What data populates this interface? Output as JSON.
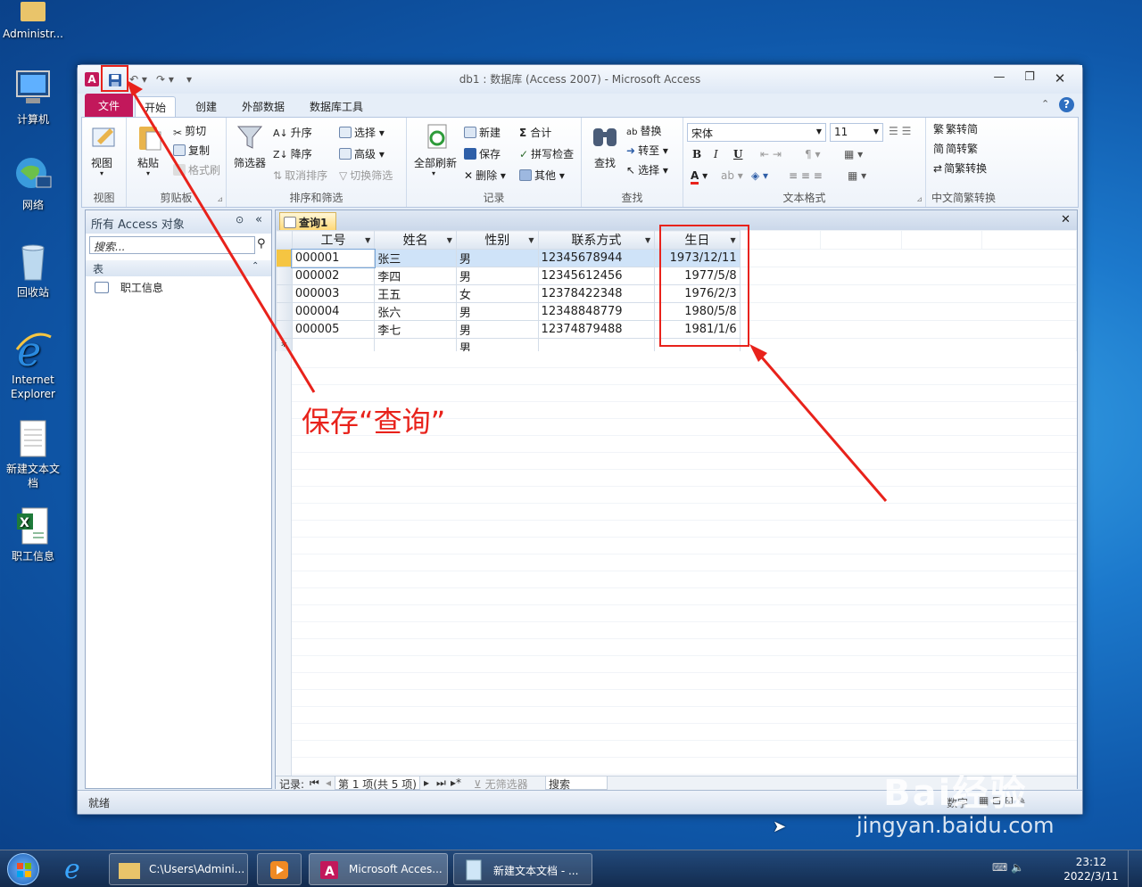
{
  "desktop": {
    "icons": [
      {
        "label": "Administr..."
      },
      {
        "label": "计算机"
      },
      {
        "label": "网络"
      },
      {
        "label": "回收站"
      },
      {
        "label": "Internet Explorer"
      },
      {
        "label": "新建文本文档"
      },
      {
        "label": "职工信息"
      }
    ]
  },
  "window": {
    "title": "db1 : 数据库 (Access 2007)  -  Microsoft Access",
    "tabs": [
      "文件",
      "开始",
      "创建",
      "外部数据",
      "数据库工具"
    ],
    "ribbon": {
      "view": {
        "label": "视图",
        "group": "视图"
      },
      "clipboard": {
        "paste": "粘贴",
        "cut": "剪切",
        "copy": "复制",
        "format_painter": "格式刷",
        "group": "剪贴板"
      },
      "sort_filter": {
        "filter": "筛选器",
        "asc": "升序",
        "desc": "降序",
        "remove_sort": "取消排序",
        "selection": "选择",
        "advanced": "高级",
        "toggle_filter": "切换筛选",
        "group": "排序和筛选"
      },
      "records": {
        "refresh_all": "全部刷新",
        "new": "新建",
        "save": "保存",
        "delete": "删除",
        "totals": "合计",
        "spelling": "拼写检查",
        "more": "其他",
        "group": "记录"
      },
      "find": {
        "find": "查找",
        "replace": "替换",
        "goto": "转至",
        "select": "选择",
        "group": "查找"
      },
      "text_format": {
        "font": "宋体",
        "size": "11",
        "bold": "B",
        "italic": "I",
        "underline": "U",
        "group": "文本格式"
      },
      "chinese": {
        "t2s": "繁转简",
        "s2t": "简转繁",
        "convert": "简繁转换",
        "group": "中文简繁转换"
      }
    },
    "nav": {
      "header": "所有 Access 对象",
      "search_placeholder": "搜索...",
      "section": "表",
      "item": "职工信息"
    },
    "doc_tab": "查询1",
    "columns": [
      "工号",
      "姓名",
      "性别",
      "联系方式",
      "生日"
    ],
    "rows": [
      [
        "000001",
        "张三",
        "男",
        "12345678944",
        "1973/12/11"
      ],
      [
        "000002",
        "李四",
        "男",
        "12345612456",
        "1977/5/8"
      ],
      [
        "000003",
        "王五",
        "女",
        "12378422348",
        "1976/2/3"
      ],
      [
        "000004",
        "张六",
        "男",
        "12348848779",
        "1980/5/8"
      ],
      [
        "000005",
        "李七",
        "男",
        "12374879488",
        "1981/1/6"
      ]
    ],
    "new_row": {
      "marker": "*",
      "gender": "男"
    },
    "record_bar": {
      "label": "记录:",
      "position": "第 1 项(共 5 项)",
      "filter": "无筛选器",
      "search": "搜索"
    },
    "status": "就绪",
    "status_right": "数字"
  },
  "annotation": {
    "text": "保存“查询”",
    "color": "#e8221b"
  },
  "taskbar": {
    "items": [
      "C:\\Users\\Admini...",
      "Microsoft Acces...",
      "新建文本文档 - ..."
    ],
    "time": "23:12",
    "date": "2022/3/11"
  },
  "watermark": {
    "brand": "Bai经验",
    "url": "jingyan.baidu.com"
  }
}
